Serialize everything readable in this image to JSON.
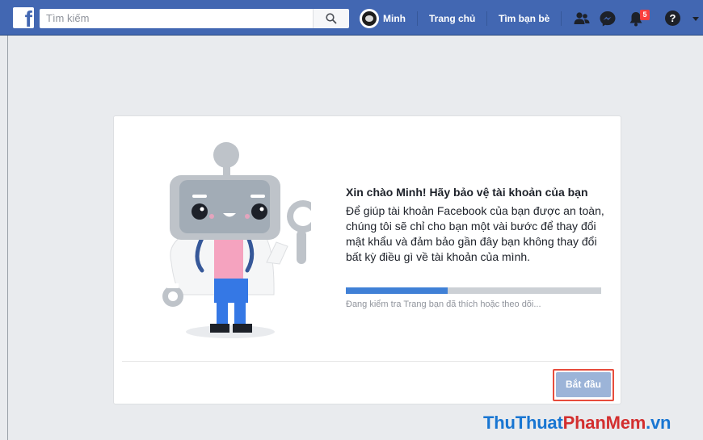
{
  "topbar": {
    "search_placeholder": "Tìm kiếm",
    "user_name": "Minh",
    "home_label": "Trang chủ",
    "find_friends_label": "Tìm bạn bè",
    "notification_count": "5",
    "help_glyph": "?"
  },
  "card": {
    "heading": "Xin chào Minh! Hãy bảo vệ tài khoản của bạn",
    "description": "Để giúp tài khoản Facebook của bạn được an toàn, chúng tôi sẽ chỉ cho bạn một vài bước để thay đổi mật khẩu và đảm bảo gần đây bạn không thay đổi bất kỳ điều gì về tài khoản của mình.",
    "progress_fraction": 0.4,
    "status_text": "Đang kiểm tra Trang bạn đã thích hoặc theo dõi...",
    "start_button": "Bắt đầu"
  },
  "watermark": {
    "part1": "ThuThuat",
    "part2": "PhanMem",
    "part3": ".vn"
  },
  "colors": {
    "brand_blue": "#4267b2",
    "progress_blue": "#4080d6",
    "highlight_red": "#e74c3c"
  },
  "icons": [
    "facebook-logo-icon",
    "search-icon",
    "friend-requests-icon",
    "messenger-icon",
    "notifications-icon",
    "help-icon",
    "account-menu-caret-icon"
  ]
}
